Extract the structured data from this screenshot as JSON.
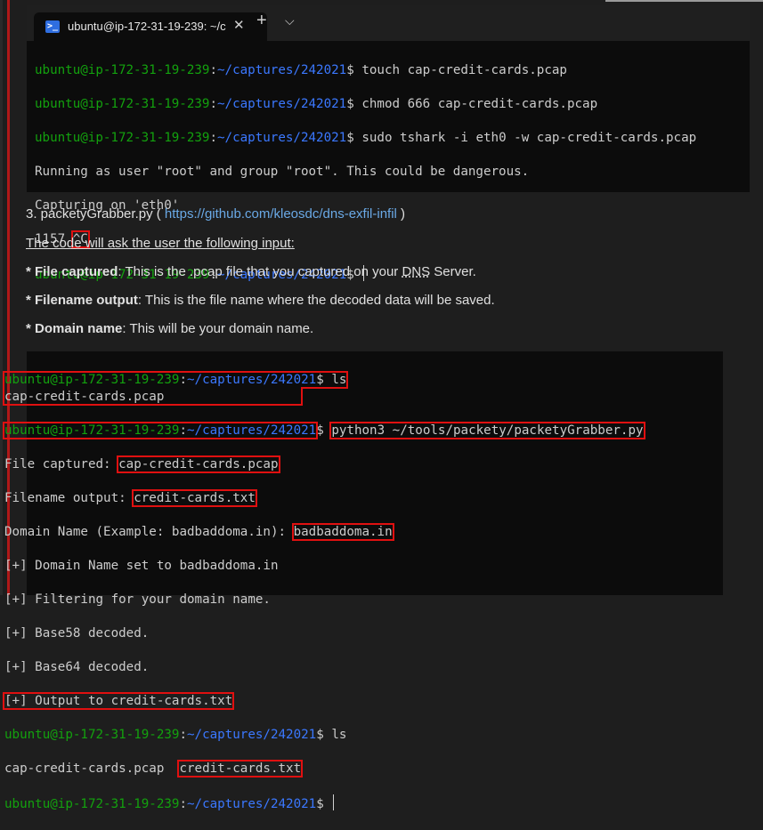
{
  "terminal1": {
    "tab_title": "ubuntu@ip-172-31-19-239: ~/c",
    "tab_icon": "terminal-icon",
    "close_glyph": "✕",
    "newtab_glyph": "+",
    "dropdown_glyph": "⌵",
    "prompt_user": "ubuntu@ip-172-31-19-239",
    "prompt_path": "~/captures/242021",
    "line1_cmd": "$ touch cap-credit-cards.pcap",
    "line2_cmd": "$ chmod 666 cap-credit-cards.pcap",
    "line3_cmd": "$ sudo tshark -i eth0 -w cap-credit-cards.pcap",
    "line4": "Running as user \"root\" and group \"root\". This could be dangerous.",
    "line5": "Capturing on 'eth0'",
    "line6_count": "1157 ",
    "line6_ctrl": "^C",
    "line7_end": "$ "
  },
  "article": {
    "item3_prefix": "3. packetyGrabber.py ( ",
    "item3_link": "https://github.com/kleosdc/dns-exfil-infil",
    "item3_suffix": " )",
    "intro": "The code will ask the user the following input:",
    "f1_star": "* ",
    "f1_bold": "File captured",
    "f1_rest_a": ": This is the .pcap file that you captured on your ",
    "f1_dns": "DNS",
    "f1_rest_b": " Server.",
    "f2_star": "* ",
    "f2_bold": "Filename output",
    "f2_rest": ": This is the file name where the decoded data will be saved.",
    "f3_star": "* ",
    "f3_bold": "Domain name",
    "f3_rest": ": This will be your domain name."
  },
  "terminal2": {
    "prompt_user": "ubuntu@ip-172-31-19-239",
    "prompt_path": "~/captures/242021",
    "l1_cmd": "$ ls",
    "l2": "cap-credit-cards.pcap",
    "l3_sep": "$ ",
    "l3_cmd": "python3 ~/tools/packety/packetyGrabber.py",
    "l4_label": "File captured: ",
    "l4_value": "cap-credit-cards.pcap",
    "l5_label": "Filename output: ",
    "l5_value": "credit-cards.txt",
    "l6_label": "Domain Name (Example: badbaddoma.in): ",
    "l6_value": "badbaddoma.in",
    "l7": "[+] Domain Name set to badbaddoma.in",
    "l8": "[+] Filtering for your domain name.",
    "l9": "[+] Base58 decoded.",
    "l10": "[+] Base64 decoded.",
    "l11": "[+] Output to credit-cards.txt",
    "l12_cmd": "$ ls",
    "l13_a": "cap-credit-cards.pcap  ",
    "l13_b": "credit-cards.txt",
    "l14_end": "$ "
  },
  "colors": {
    "background": "#1e1e1e",
    "terminal_bg": "#0c0c0c",
    "prompt_user": "#13a10e",
    "prompt_path": "#3b78ff",
    "highlight_box": "#e01010",
    "link": "#6aa9e6",
    "left_rule": "#b01818"
  }
}
